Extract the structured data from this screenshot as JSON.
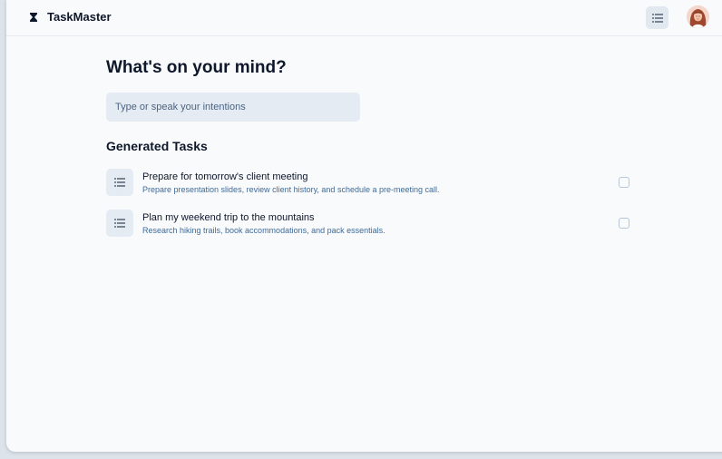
{
  "app": {
    "name": "TaskMaster",
    "logo_icon": "hourglass-icon",
    "menu_icon": "list-icon",
    "avatar_icon": "user-avatar"
  },
  "main": {
    "heading": "What's on your mind?",
    "input": {
      "placeholder": "Type or speak your intentions",
      "value": ""
    },
    "section_title": "Generated Tasks",
    "tasks": [
      {
        "title": "Prepare for tomorrow's client meeting",
        "description": "Prepare presentation slides, review client history, and schedule a pre-meeting call.",
        "checked": false,
        "icon": "list-icon"
      },
      {
        "title": "Plan my weekend trip to the mountains",
        "description": "Research hiking trails, book accommodations, and pack essentials.",
        "checked": false,
        "icon": "list-icon"
      }
    ]
  },
  "colors": {
    "background": "#f8fafc",
    "text_primary": "#0f172a",
    "text_secondary": "#3f6a99",
    "surface": "#e4ebf3"
  }
}
